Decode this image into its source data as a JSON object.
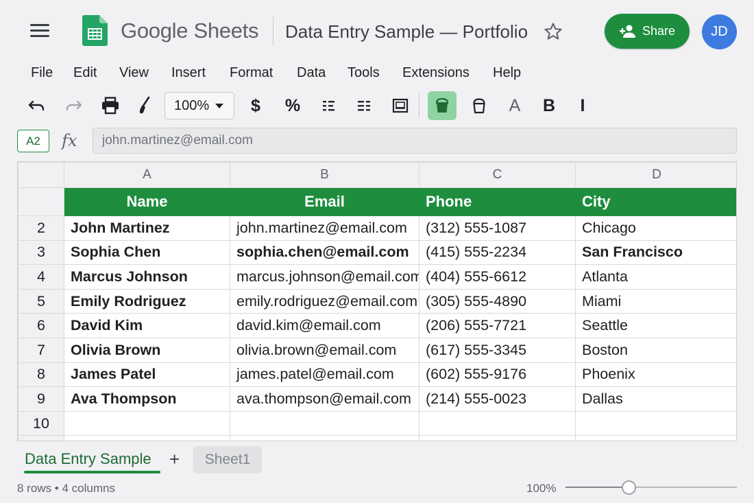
{
  "app": {
    "brand": "Google Sheets",
    "doc_title": "Data Entry Sample — Portfolio",
    "share_label": "Share",
    "avatar_initials": "JD",
    "accent_color": "#1e8e3e",
    "avatar_color": "#3d7be0"
  },
  "menu": [
    "File",
    "Edit",
    "View",
    "Insert",
    "Format",
    "Data",
    "Tools",
    "Extensions",
    "Help"
  ],
  "toolbar": {
    "zoom": "100%",
    "currency": "$",
    "percent": "%",
    "text_color": "A",
    "bold": "B",
    "italic": "I",
    "icons": [
      "undo-icon",
      "redo-icon",
      "print-icon",
      "paint-format-icon",
      "align-left-icon",
      "align-right-icon",
      "table-icon",
      "fill-color-icon",
      "border-bucket-icon"
    ]
  },
  "formula_bar": {
    "cell_ref": "A2",
    "fx": "fx",
    "value": "john.martinez@email.com"
  },
  "grid": {
    "column_letters": [
      "A",
      "B",
      "C",
      "D"
    ],
    "headers": [
      "Name",
      "Email",
      "Phone",
      "City"
    ],
    "header_row_number": "",
    "rows": [
      {
        "num": "2",
        "name": "John Martinez",
        "email": "john.martinez@email.com",
        "phone": "(312) 555-1087",
        "city": "Chicago"
      },
      {
        "num": "3",
        "name": "Sophia Chen",
        "email": "sophia.chen@email.com",
        "phone": "(415) 555-2234",
        "city": "San Francisco"
      },
      {
        "num": "4",
        "name": "Marcus Johnson",
        "email": "marcus.johnson@email.com",
        "phone": "(404) 555-6612",
        "city": "Atlanta"
      },
      {
        "num": "5",
        "name": "Emily Rodriguez",
        "email": "emily.rodriguez@email.com",
        "phone": "(305) 555-4890",
        "city": "Miami"
      },
      {
        "num": "6",
        "name": "David Kim",
        "email": "david.kim@email.com",
        "phone": "(206) 555-7721",
        "city": "Seattle"
      },
      {
        "num": "7",
        "name": "Olivia Brown",
        "email": "olivia.brown@email.com",
        "phone": "(617) 555-3345",
        "city": "Boston"
      },
      {
        "num": "8",
        "name": "James Patel",
        "email": "james.patel@email.com",
        "phone": "(602) 555-9176",
        "city": "Phoenix"
      },
      {
        "num": "9",
        "name": "Ava Thompson",
        "email": "ava.thompson@email.com",
        "phone": "(214) 555-0023",
        "city": "Dallas"
      }
    ],
    "empty_row_num": "10"
  },
  "sheets": {
    "active": "Data Entry Sample",
    "add": "+",
    "other": "Sheet1"
  },
  "status": {
    "summary": "8 rows • 4 columns",
    "zoom": "100%",
    "zoom_level": 0.35
  }
}
